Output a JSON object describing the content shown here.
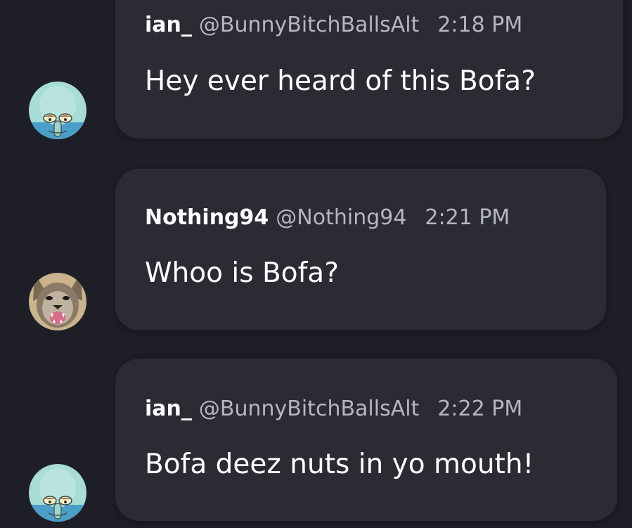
{
  "messages": [
    {
      "name": "ian_",
      "handle": "@BunnyBitchBallsAlt",
      "time": "2:18 PM",
      "text": "Hey ever heard of this Bofa?",
      "avatar": "squidward-avatar"
    },
    {
      "name": "Nothing94",
      "handle": "@Nothing94",
      "time": "2:21 PM",
      "text": "Whoo is Bofa?",
      "avatar": "wildcat-avatar"
    },
    {
      "name": "ian_",
      "handle": "@BunnyBitchBallsAlt",
      "time": "2:22 PM",
      "text": "Bofa deez nuts in yo mouth!",
      "avatar": "squidward-avatar"
    }
  ],
  "colors": {
    "background": "#1e1f26",
    "bubble": "#2a2b33",
    "name_text": "#ffffff",
    "muted_text": "#b4b6c0"
  }
}
